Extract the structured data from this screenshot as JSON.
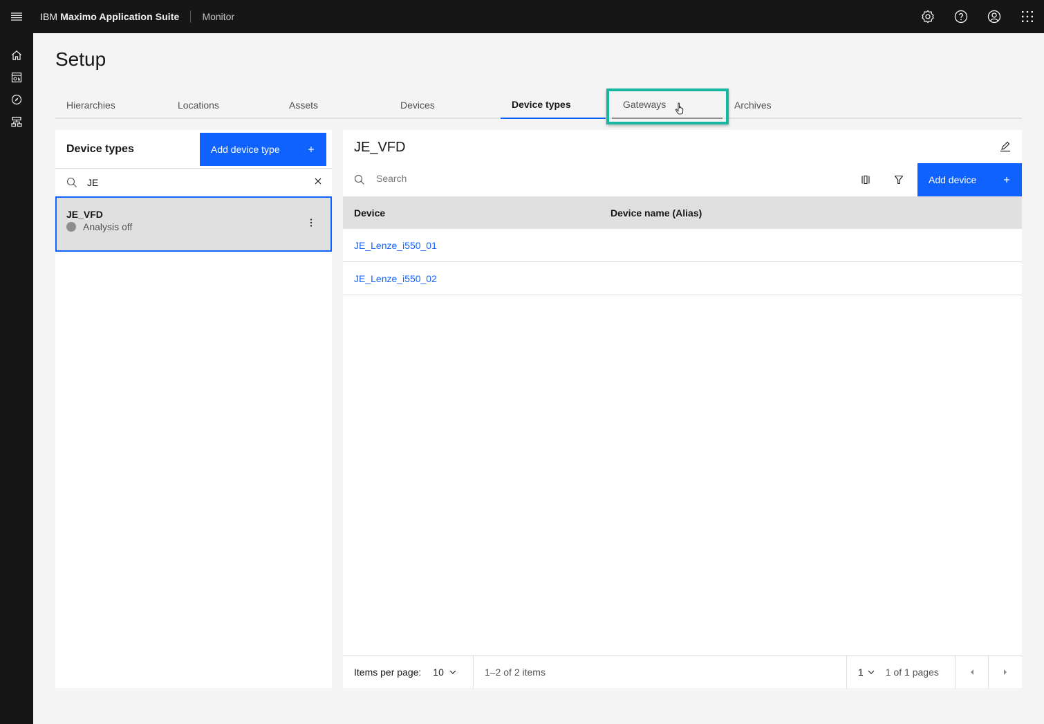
{
  "header": {
    "brand_prefix": "IBM",
    "brand_name": "Maximo Application Suite",
    "app_name": "Monitor",
    "icons": [
      "menu-icon",
      "settings-icon",
      "help-icon",
      "user-avatar-icon",
      "app-switcher-icon"
    ]
  },
  "sidenav": {
    "items": [
      {
        "name": "home",
        "icon": "home-icon"
      },
      {
        "name": "dashboards",
        "icon": "dashboard-icon"
      },
      {
        "name": "monitor",
        "icon": "compass-icon"
      },
      {
        "name": "setup",
        "icon": "hierarchy-icon"
      }
    ]
  },
  "page": {
    "title": "Setup"
  },
  "tabs": [
    {
      "label": "Hierarchies",
      "active": false
    },
    {
      "label": "Locations",
      "active": false
    },
    {
      "label": "Assets",
      "active": false
    },
    {
      "label": "Devices",
      "active": false
    },
    {
      "label": "Device types",
      "active": true
    },
    {
      "label": "Gateways",
      "active": false,
      "hovered": true
    },
    {
      "label": "Archives",
      "active": false
    }
  ],
  "left_panel": {
    "title": "Device types",
    "add_button_label": "Add device type",
    "search_value": "JE",
    "items": [
      {
        "name": "JE_VFD",
        "status": "Analysis off",
        "status_color": "#8d8d8d",
        "selected": true
      }
    ]
  },
  "right_panel": {
    "title": "JE_VFD",
    "search_placeholder": "Search",
    "add_button_label": "Add device",
    "columns": [
      "Device",
      "Device name (Alias)"
    ],
    "rows": [
      {
        "device": "JE_Lenze_i550_01",
        "alias": ""
      },
      {
        "device": "JE_Lenze_i550_02",
        "alias": ""
      }
    ],
    "pagination": {
      "items_per_page_label": "Items per page:",
      "items_per_page": "10",
      "range_text": "1–2 of 2 items",
      "current_page": "1",
      "pages_text": "1 of 1 pages"
    }
  },
  "colors": {
    "primary": "#0f62fe",
    "highlight": "#14b8a0",
    "header_bg": "#161616",
    "page_bg": "#f4f4f4"
  }
}
